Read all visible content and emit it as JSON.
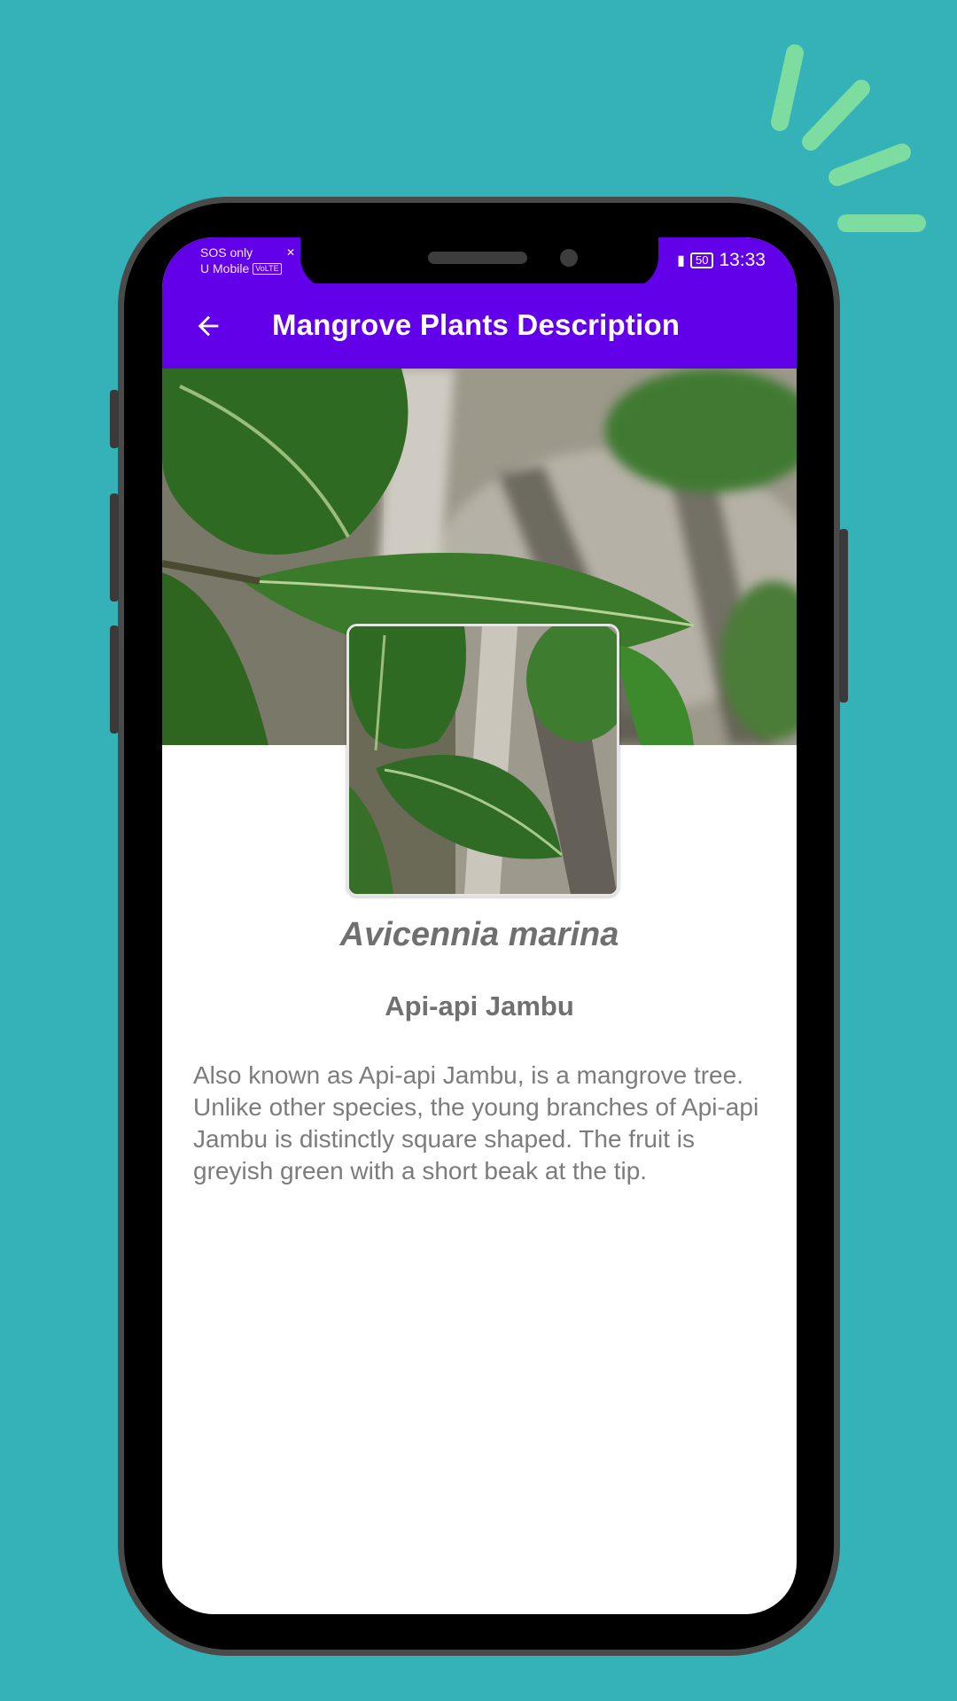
{
  "status_bar": {
    "carrier_line1": "SOS only",
    "carrier_line2": "U Mobile",
    "volte_badge": "VoLTE",
    "battery": "50",
    "time": "13:33"
  },
  "app_bar": {
    "back_icon": "arrow-left-icon",
    "title": "Mangrove Plants Description"
  },
  "plant": {
    "scientific_name": "Avicennia marina",
    "common_name": "Api-api Jambu",
    "description": "Also known as Api-api Jambu, is a mangrove tree. Unlike other species, the young branches of Api-api Jambu is distinctly square shaped. The fruit is greyish green with a short beak at the tip."
  },
  "colors": {
    "background": "#35b1b8",
    "app_bar": "#6200ea",
    "sparkle": "#7ddc9f",
    "phone_frame": "#4a4a4a"
  }
}
